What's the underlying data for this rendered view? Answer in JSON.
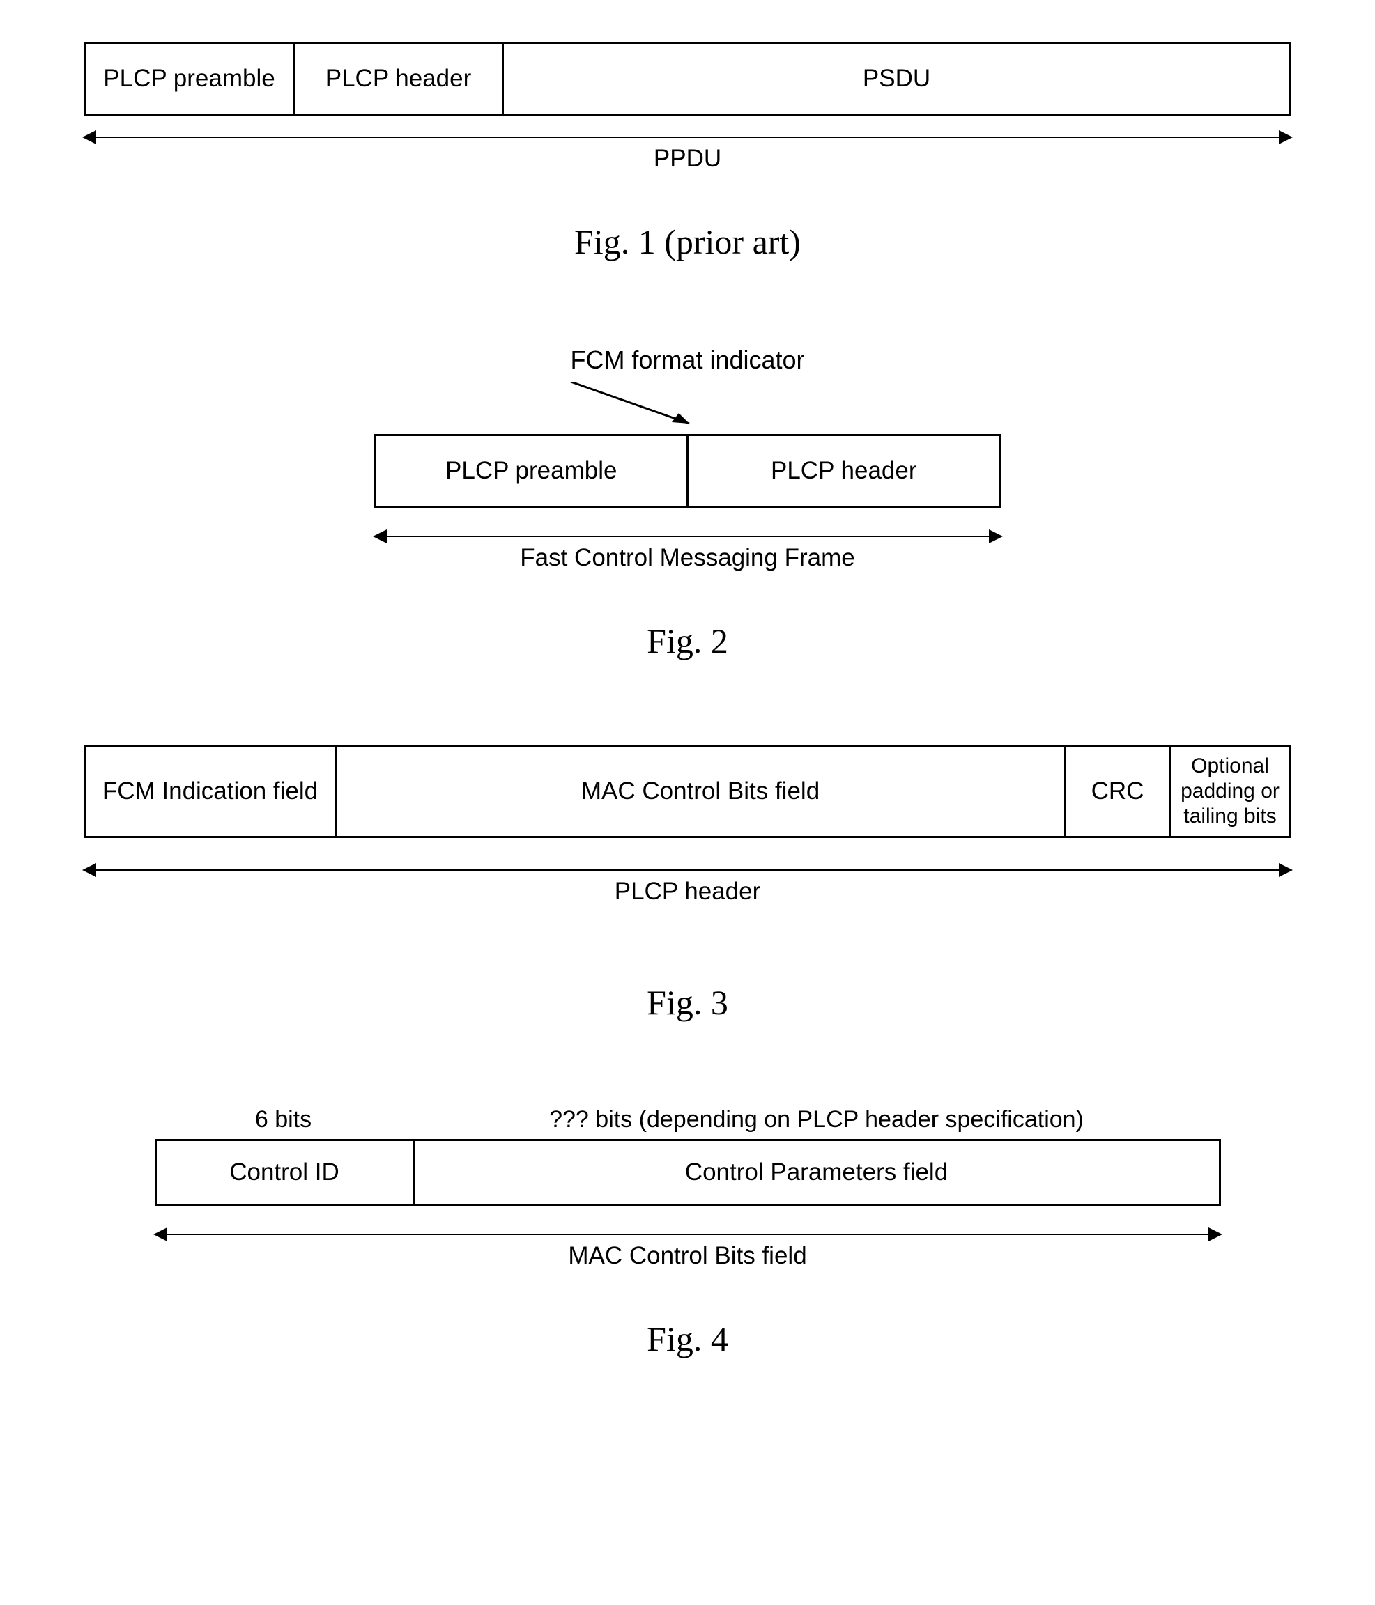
{
  "fig1": {
    "cells": [
      "PLCP preamble",
      "PLCP header",
      "PSDU"
    ],
    "arrow_label": "PPDU",
    "caption": "Fig. 1 (prior art)"
  },
  "fig2": {
    "indicator_label": "FCM format indicator",
    "cells": [
      "PLCP preamble",
      "PLCP header"
    ],
    "arrow_label": "Fast Control Messaging Frame",
    "caption": "Fig. 2"
  },
  "fig3": {
    "cells": [
      "FCM Indication field",
      "MAC Control Bits field",
      "CRC",
      "Optional padding or tailing bits"
    ],
    "arrow_label": "PLCP header",
    "caption": "Fig. 3"
  },
  "fig4": {
    "bits_labels": [
      "6 bits",
      "??? bits (depending on PLCP header specification)"
    ],
    "cells": [
      "Control ID",
      "Control Parameters field"
    ],
    "arrow_label": "MAC Control Bits field",
    "caption": "Fig. 4"
  }
}
